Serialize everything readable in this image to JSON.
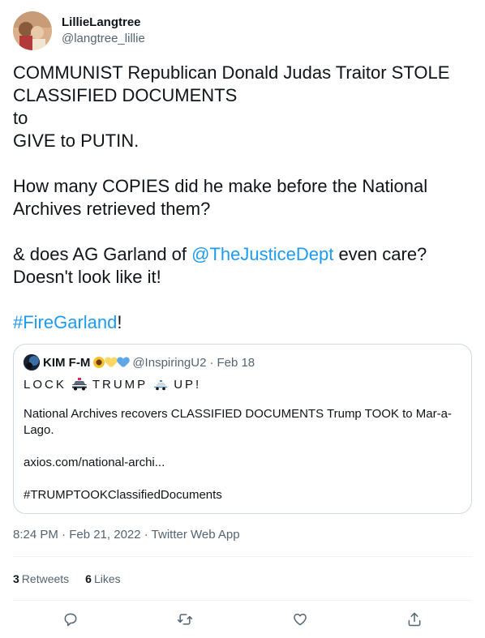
{
  "author": {
    "display_name": "LillieLangtree",
    "handle": "@langtree_lillie"
  },
  "tweet": {
    "para1": "COMMUNIST Republican Donald Judas Traitor STOLE\nCLASSIFIED DOCUMENTS\nto\nGIVE to PUTIN.",
    "para2": "How many COPIES did he make before the National\nArchives retrieved them?",
    "para3_before": "& does AG Garland of ",
    "para3_mention": "@TheJusticeDept",
    "para3_after": " even care?\nDoesn't look like it!",
    "hashtag": "#FireGarland",
    "hashtag_suffix": "!"
  },
  "quote": {
    "display_name": "KIM F-M",
    "handle": "@InspiringU2",
    "separator": "·",
    "date": "Feb 18",
    "lock": "LOCK",
    "trump": "TRUMP",
    "up": "UP!",
    "body1": "National Archives recovers CLASSIFIED DOCUMENTS Trump TOOK to Mar-a-Lago.",
    "body2": "axios.com/national-archi...",
    "body3": "#TRUMPTOOKClassifiedDocuments"
  },
  "meta": {
    "timestamp": "8:24 PM · Feb 21, 2022 · Twitter Web App"
  },
  "stats": {
    "retweets_count": "3",
    "retweets_label": "Retweets",
    "likes_count": "6",
    "likes_label": "Likes"
  },
  "icons": {
    "reply": "reply-icon",
    "retweet": "retweet-icon",
    "like": "like-icon",
    "share": "share-icon"
  },
  "colors": {
    "link": "#1d9bf0",
    "secondary_text": "#536471",
    "border": "#cfd9de"
  }
}
